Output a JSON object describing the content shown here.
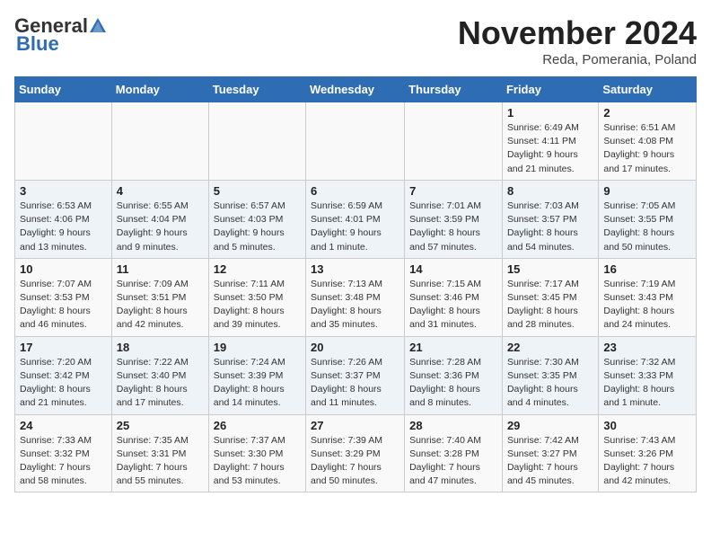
{
  "header": {
    "logo_general": "General",
    "logo_blue": "Blue",
    "month_title": "November 2024",
    "location": "Reda, Pomerania, Poland"
  },
  "columns": [
    "Sunday",
    "Monday",
    "Tuesday",
    "Wednesday",
    "Thursday",
    "Friday",
    "Saturday"
  ],
  "weeks": [
    [
      {
        "day": "",
        "info": ""
      },
      {
        "day": "",
        "info": ""
      },
      {
        "day": "",
        "info": ""
      },
      {
        "day": "",
        "info": ""
      },
      {
        "day": "",
        "info": ""
      },
      {
        "day": "1",
        "info": "Sunrise: 6:49 AM\nSunset: 4:11 PM\nDaylight: 9 hours and 21 minutes."
      },
      {
        "day": "2",
        "info": "Sunrise: 6:51 AM\nSunset: 4:08 PM\nDaylight: 9 hours and 17 minutes."
      }
    ],
    [
      {
        "day": "3",
        "info": "Sunrise: 6:53 AM\nSunset: 4:06 PM\nDaylight: 9 hours and 13 minutes."
      },
      {
        "day": "4",
        "info": "Sunrise: 6:55 AM\nSunset: 4:04 PM\nDaylight: 9 hours and 9 minutes."
      },
      {
        "day": "5",
        "info": "Sunrise: 6:57 AM\nSunset: 4:03 PM\nDaylight: 9 hours and 5 minutes."
      },
      {
        "day": "6",
        "info": "Sunrise: 6:59 AM\nSunset: 4:01 PM\nDaylight: 9 hours and 1 minute."
      },
      {
        "day": "7",
        "info": "Sunrise: 7:01 AM\nSunset: 3:59 PM\nDaylight: 8 hours and 57 minutes."
      },
      {
        "day": "8",
        "info": "Sunrise: 7:03 AM\nSunset: 3:57 PM\nDaylight: 8 hours and 54 minutes."
      },
      {
        "day": "9",
        "info": "Sunrise: 7:05 AM\nSunset: 3:55 PM\nDaylight: 8 hours and 50 minutes."
      }
    ],
    [
      {
        "day": "10",
        "info": "Sunrise: 7:07 AM\nSunset: 3:53 PM\nDaylight: 8 hours and 46 minutes."
      },
      {
        "day": "11",
        "info": "Sunrise: 7:09 AM\nSunset: 3:51 PM\nDaylight: 8 hours and 42 minutes."
      },
      {
        "day": "12",
        "info": "Sunrise: 7:11 AM\nSunset: 3:50 PM\nDaylight: 8 hours and 39 minutes."
      },
      {
        "day": "13",
        "info": "Sunrise: 7:13 AM\nSunset: 3:48 PM\nDaylight: 8 hours and 35 minutes."
      },
      {
        "day": "14",
        "info": "Sunrise: 7:15 AM\nSunset: 3:46 PM\nDaylight: 8 hours and 31 minutes."
      },
      {
        "day": "15",
        "info": "Sunrise: 7:17 AM\nSunset: 3:45 PM\nDaylight: 8 hours and 28 minutes."
      },
      {
        "day": "16",
        "info": "Sunrise: 7:19 AM\nSunset: 3:43 PM\nDaylight: 8 hours and 24 minutes."
      }
    ],
    [
      {
        "day": "17",
        "info": "Sunrise: 7:20 AM\nSunset: 3:42 PM\nDaylight: 8 hours and 21 minutes."
      },
      {
        "day": "18",
        "info": "Sunrise: 7:22 AM\nSunset: 3:40 PM\nDaylight: 8 hours and 17 minutes."
      },
      {
        "day": "19",
        "info": "Sunrise: 7:24 AM\nSunset: 3:39 PM\nDaylight: 8 hours and 14 minutes."
      },
      {
        "day": "20",
        "info": "Sunrise: 7:26 AM\nSunset: 3:37 PM\nDaylight: 8 hours and 11 minutes."
      },
      {
        "day": "21",
        "info": "Sunrise: 7:28 AM\nSunset: 3:36 PM\nDaylight: 8 hours and 8 minutes."
      },
      {
        "day": "22",
        "info": "Sunrise: 7:30 AM\nSunset: 3:35 PM\nDaylight: 8 hours and 4 minutes."
      },
      {
        "day": "23",
        "info": "Sunrise: 7:32 AM\nSunset: 3:33 PM\nDaylight: 8 hours and 1 minute."
      }
    ],
    [
      {
        "day": "24",
        "info": "Sunrise: 7:33 AM\nSunset: 3:32 PM\nDaylight: 7 hours and 58 minutes."
      },
      {
        "day": "25",
        "info": "Sunrise: 7:35 AM\nSunset: 3:31 PM\nDaylight: 7 hours and 55 minutes."
      },
      {
        "day": "26",
        "info": "Sunrise: 7:37 AM\nSunset: 3:30 PM\nDaylight: 7 hours and 53 minutes."
      },
      {
        "day": "27",
        "info": "Sunrise: 7:39 AM\nSunset: 3:29 PM\nDaylight: 7 hours and 50 minutes."
      },
      {
        "day": "28",
        "info": "Sunrise: 7:40 AM\nSunset: 3:28 PM\nDaylight: 7 hours and 47 minutes."
      },
      {
        "day": "29",
        "info": "Sunrise: 7:42 AM\nSunset: 3:27 PM\nDaylight: 7 hours and 45 minutes."
      },
      {
        "day": "30",
        "info": "Sunrise: 7:43 AM\nSunset: 3:26 PM\nDaylight: 7 hours and 42 minutes."
      }
    ]
  ]
}
